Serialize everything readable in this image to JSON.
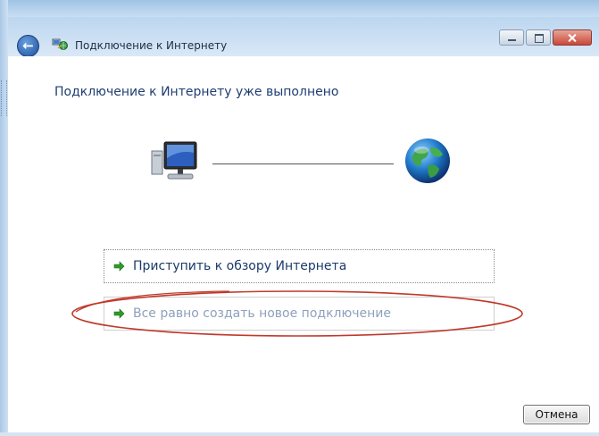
{
  "window": {
    "title": "Подключение к Интернету",
    "controls": [
      "minimize-icon",
      "maximize-icon",
      "close-icon"
    ]
  },
  "nav": {
    "back_icon": "back-arrow-icon",
    "app_icon": "network-icon"
  },
  "main": {
    "headline": "Подключение к Интернету уже выполнено",
    "status_icons": [
      "computer-icon",
      "globe-icon"
    ]
  },
  "commands": [
    {
      "label": "Приступить к обзору Интернета",
      "icon": "green-arrow-icon"
    },
    {
      "label": "Все равно создать новое подключение",
      "icon": "green-arrow-icon"
    }
  ],
  "footer": {
    "cancel_label": "Отмена"
  },
  "colors": {
    "headline": "#1f3d73",
    "link": "#1b3a6b",
    "link_disabled": "#8ea1bd",
    "annotation": "#c0392b",
    "accent_arrow": "#2f9a2a"
  }
}
